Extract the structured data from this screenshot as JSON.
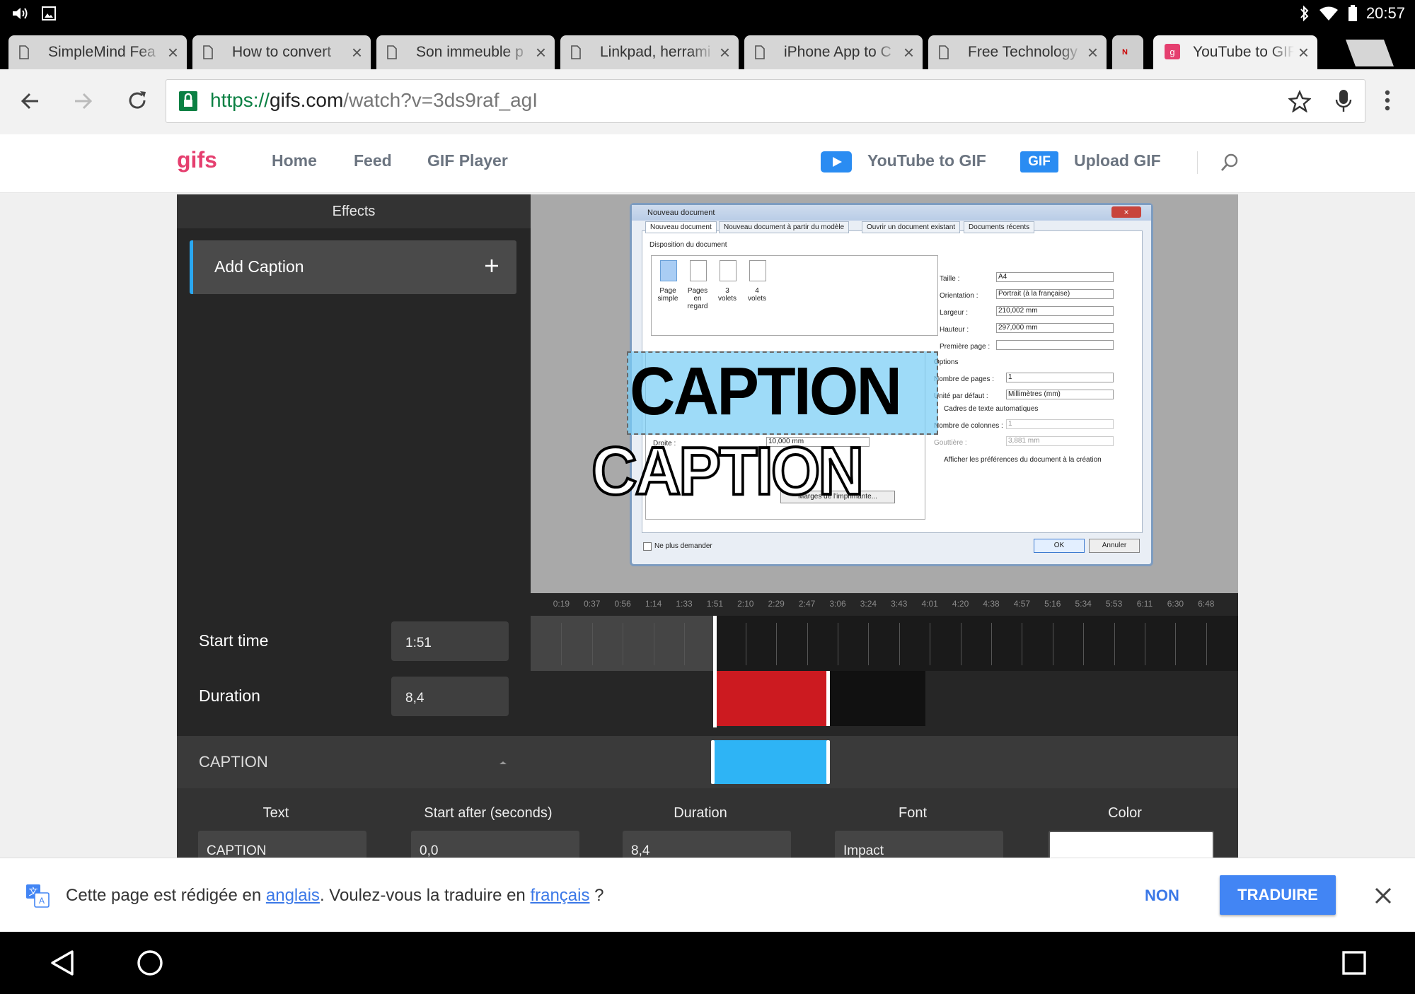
{
  "status": {
    "time": "20:57"
  },
  "tabs": [
    {
      "label": "SimpleMind Fea"
    },
    {
      "label": "How to convert"
    },
    {
      "label": "Son immeuble p"
    },
    {
      "label": "Linkpad, herrami"
    },
    {
      "label": "iPhone App to C"
    },
    {
      "label": "Free Technology"
    },
    {
      "label": "YouTube to GIF"
    }
  ],
  "omnibox": {
    "scheme": "https://",
    "host": "gifs.com",
    "path": "/watch?v=3ds9raf_agI"
  },
  "site": {
    "logo": "gifs",
    "nav": [
      "Home",
      "Feed",
      "GIF Player"
    ],
    "youtube_to_gif": "YouTube to GIF",
    "gif_badge": "GIF",
    "upload_gif": "Upload GIF"
  },
  "effects": {
    "title": "Effects",
    "add_caption": "Add Caption"
  },
  "preview": {
    "dialog": {
      "title": "Nouveau document",
      "tabs": [
        "Nouveau document",
        "Nouveau document à partir du modèle",
        "Ouvrir un document existant",
        "Documents récents"
      ],
      "group_title": "Disposition du document",
      "layouts": [
        "Page simple",
        "Pages en regard",
        "3 volets",
        "4 volets"
      ],
      "fields": [
        {
          "label": "Taille :",
          "value": "A4"
        },
        {
          "label": "Orientation :",
          "value": "Portrait (à la française)"
        },
        {
          "label": "Largeur :",
          "value": "210,002 mm"
        },
        {
          "label": "Hauteur :",
          "value": "297,000 mm"
        },
        {
          "label": "Première page :",
          "value": ""
        }
      ],
      "options_title": "Options",
      "options": [
        {
          "label": "Nombre de pages :",
          "value": "1"
        },
        {
          "label": "Unité par défaut :",
          "value": "Millimètres (mm)"
        },
        {
          "label": "Cadres de texte automatiques",
          "value": ""
        },
        {
          "label": "Nombre de colonnes :",
          "value": "1"
        },
        {
          "label": "Gouttière :",
          "value": "3,881 mm"
        },
        {
          "label": "Afficher les préférences du document à la création",
          "value": ""
        }
      ],
      "margins_button": "Marges de l'imprimante...",
      "inner_right_label": "Droite :",
      "inner_right_value": "10,000 mm",
      "dont_ask": "Ne plus demander",
      "ok": "OK",
      "cancel": "Annuler"
    },
    "caption_selected": "CAPTION",
    "caption_outline": "CAPTION"
  },
  "timeline": {
    "ticks": [
      "0:19",
      "0:37",
      "0:56",
      "1:14",
      "1:33",
      "1:51",
      "2:10",
      "2:29",
      "2:47",
      "3:06",
      "3:24",
      "3:43",
      "4:01",
      "4:20",
      "4:38",
      "4:57",
      "5:16",
      "5:34",
      "5:53",
      "6:11",
      "6:30",
      "6:48"
    ],
    "start_label": "Start time",
    "start_value": "1:51",
    "duration_label": "Duration",
    "duration_value": "8,4"
  },
  "caption_section": {
    "title": "CAPTION"
  },
  "caption_props": {
    "text_label": "Text",
    "text_value": "CAPTION",
    "start_label": "Start after (seconds)",
    "start_value": "0,0",
    "duration_label": "Duration",
    "duration_value": "8,4",
    "font_label": "Font",
    "font_value": "Impact",
    "color_label": "Color",
    "color_value": "#ffffff"
  },
  "translate": {
    "text_before": "Cette page est rédigée en ",
    "lang_from": "anglais",
    "text_middle": ". Voulez-vous la traduire en ",
    "lang_to": "français",
    "text_after": " ?",
    "non": "NON",
    "traduire": "TRADUIRE"
  },
  "colors": {
    "accent_blue": "#2aa7f0",
    "timeline_red": "#cc1a20",
    "timeline_blue": "#2eb4f5",
    "brand_pink": "#e53f6f",
    "translate_blue": "#4285f4"
  }
}
